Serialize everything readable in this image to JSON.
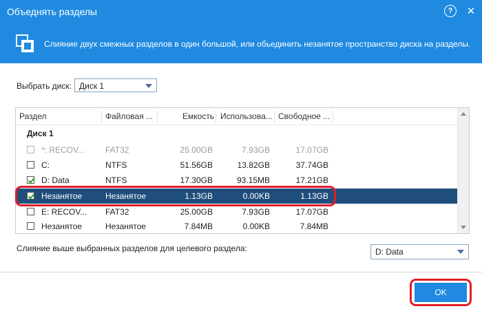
{
  "window": {
    "title": "Объеднять разделы",
    "help_icon": "help-icon",
    "help_glyph": "?",
    "close_icon": "close-icon",
    "close_glyph": "✕"
  },
  "banner": {
    "icon": "merge-partitions-icon",
    "description": "Слияние двух смежных разделов в один большой, или обьединить незанятое пространство диска на разделы."
  },
  "disk_select": {
    "label": "Выбрать диск:",
    "value": "Диск 1"
  },
  "table": {
    "columns": [
      "Раздел",
      "Файловая ...",
      "Емкость",
      "Использова...",
      "Свободное ..."
    ],
    "group": "Диск 1",
    "rows": [
      {
        "partition": "*: RECOV...",
        "fs": "FAT32",
        "capacity": "25.00GB",
        "used": "7.93GB",
        "free": "17.07GB",
        "checked": false,
        "disabled": true,
        "selected": false
      },
      {
        "partition": "C:",
        "fs": "NTFS",
        "capacity": "51.56GB",
        "used": "13.82GB",
        "free": "37.74GB",
        "checked": false,
        "disabled": false,
        "selected": false
      },
      {
        "partition": "D: Data",
        "fs": "NTFS",
        "capacity": "17.30GB",
        "used": "93.15MB",
        "free": "17.21GB",
        "checked": true,
        "disabled": false,
        "selected": false
      },
      {
        "partition": "Незанятое",
        "fs": "Незанятое",
        "capacity": "1.13GB",
        "used": "0.00KB",
        "free": "1.13GB",
        "checked": true,
        "disabled": false,
        "selected": true
      },
      {
        "partition": "E: RECOV...",
        "fs": "FAT32",
        "capacity": "25.00GB",
        "used": "7.93GB",
        "free": "17.07GB",
        "checked": false,
        "disabled": false,
        "selected": false
      },
      {
        "partition": "Незанятое",
        "fs": "Незанятое",
        "capacity": "7.84MB",
        "used": "0.00KB",
        "free": "7.84MB",
        "checked": false,
        "disabled": false,
        "selected": false
      }
    ]
  },
  "merge_target": {
    "label": "Слияние выше выбранных разделов для целевого раздела:",
    "value": "D: Data"
  },
  "footer": {
    "ok_label": "OK"
  },
  "colors": {
    "accent": "#1f8ae0",
    "selected_row": "#1f4e7c",
    "highlight_ring": "#e01e2a"
  }
}
